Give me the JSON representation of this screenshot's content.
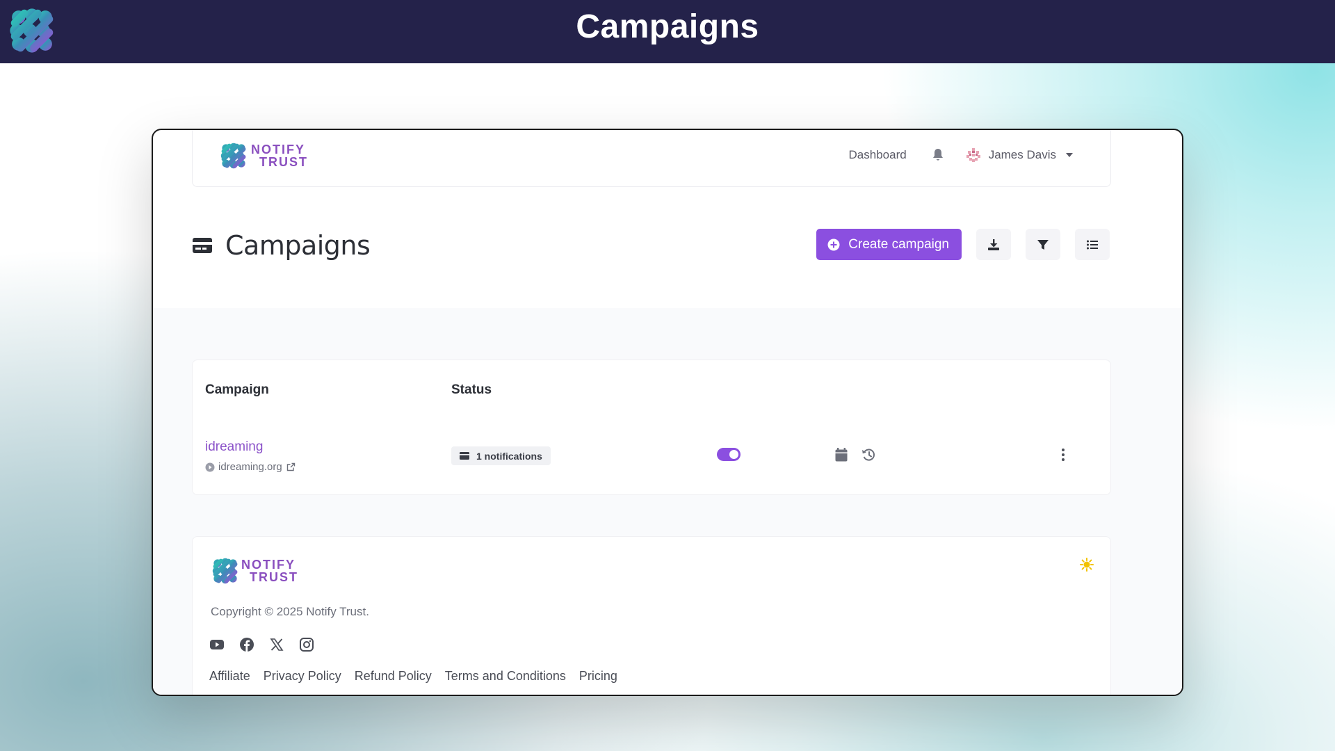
{
  "header": {
    "title": "Campaigns"
  },
  "navbar": {
    "brand_line1": "NOTIFY",
    "brand_line2": "TRUST",
    "dashboard_label": "Dashboard",
    "user_name": "James Davis"
  },
  "page": {
    "title": "Campaigns",
    "create_label": "Create campaign"
  },
  "table": {
    "columns": [
      "Campaign",
      "Status"
    ],
    "rows": [
      {
        "name": "idreaming",
        "url": "idreaming.org",
        "notifications": "1 notifications",
        "enabled": true
      }
    ]
  },
  "footer": {
    "brand_line1": "NOTIFY",
    "brand_line2": "TRUST",
    "copyright": "Copyright © 2025 Notify Trust.",
    "socials": [
      "youtube-icon",
      "facebook-icon",
      "x-icon",
      "instagram-icon"
    ],
    "links": [
      "Affiliate",
      "Privacy Policy",
      "Refund Policy",
      "Terms and Conditions",
      "Pricing"
    ]
  },
  "colors": {
    "accent": "#8b4fe0",
    "header_bg": "#24224a",
    "brand_text": "#8a4fbf",
    "link": "#8b52c9"
  }
}
